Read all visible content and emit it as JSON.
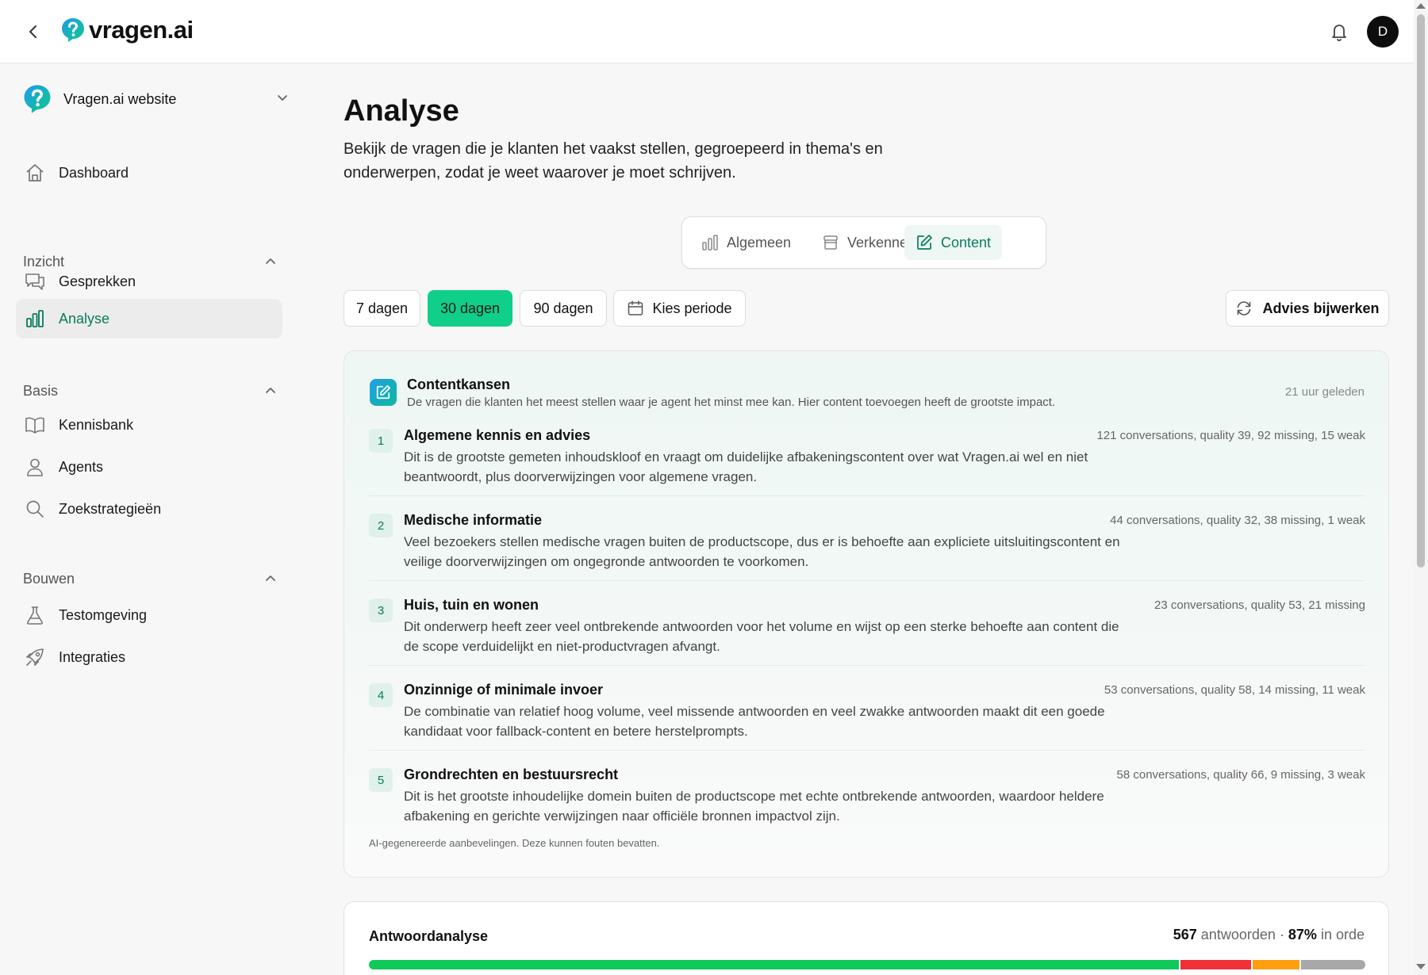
{
  "brand": {
    "name": "vragen.ai",
    "accent": "#0fcf8a"
  },
  "header": {
    "avatar_initial": "D"
  },
  "sidebar": {
    "workspace": "Vragen.ai website",
    "dashboard": "Dashboard",
    "sections": [
      {
        "title": "Inzicht",
        "items": [
          {
            "label": "Gesprekken",
            "icon": "chat-icon"
          },
          {
            "label": "Analyse",
            "icon": "bar-chart-icon",
            "active": true
          }
        ]
      },
      {
        "title": "Basis",
        "items": [
          {
            "label": "Kennisbank",
            "icon": "book-icon"
          },
          {
            "label": "Agents",
            "icon": "user-icon"
          },
          {
            "label": "Zoekstrategieën",
            "icon": "search-icon"
          }
        ]
      },
      {
        "title": "Bouwen",
        "items": [
          {
            "label": "Testomgeving",
            "icon": "flask-icon"
          },
          {
            "label": "Integraties",
            "icon": "rocket-icon"
          }
        ]
      }
    ]
  },
  "page": {
    "title": "Analyse",
    "description": "Bekijk de vragen die je klanten het vaakst stellen, gegroepeerd in thema's en onderwerpen, zodat je weet waarover je moet schrijven."
  },
  "tabs": [
    {
      "label": "Algemeen",
      "icon": "bar-chart-icon"
    },
    {
      "label": "Verkennen",
      "icon": "archive-icon"
    },
    {
      "label": "Content",
      "icon": "edit-icon",
      "active": true
    }
  ],
  "periods": {
    "p7": "7 dagen",
    "p30": "30 dagen",
    "p90": "90 dagen",
    "custom": "Kies periode",
    "selected": "30 dagen"
  },
  "advice_button": "Advies bijwerken",
  "contentkansen": {
    "title": "Contentkansen",
    "subtitle": "De vragen die klanten het meest stellen waar je agent het minst mee kan. Hier content toevoegen heeft de grootste impact.",
    "updated": "21 uur geleden",
    "items": [
      {
        "num": "1",
        "title": "Algemene kennis en advies",
        "desc": "Dit is de grootste gemeten inhoudskloof en vraagt om duidelijke afbakeningscontent over wat Vragen.ai wel en niet beantwoordt, plus doorverwijzingen voor algemene vragen.",
        "stats": "121 conversations, quality 39, 92 missing, 15 weak"
      },
      {
        "num": "2",
        "title": "Medische informatie",
        "desc": "Veel bezoekers stellen medische vragen buiten de productscope, dus er is behoefte aan expliciete uitsluitingscontent en veilige doorverwijzingen om ongegronde antwoorden te voorkomen.",
        "stats": "44 conversations, quality 32, 38 missing, 1 weak"
      },
      {
        "num": "3",
        "title": "Huis, tuin en wonen",
        "desc": "Dit onderwerp heeft zeer veel ontbrekende antwoorden voor het volume en wijst op een sterke behoefte aan content die de scope verduidelijkt en niet-productvragen afvangt.",
        "stats": "23 conversations, quality 53, 21 missing"
      },
      {
        "num": "4",
        "title": "Onzinnige of minimale invoer",
        "desc": "De combinatie van relatief hoog volume, veel missende antwoorden en veel zwakke antwoorden maakt dit een goede kandidaat voor fallback-content en betere herstelprompts.",
        "stats": "53 conversations, quality 58, 14 missing, 11 weak"
      },
      {
        "num": "5",
        "title": "Grondrechten en bestuursrecht",
        "desc": "Dit is het grootste inhoudelijke domein buiten de productscope met echte ontbrekende antwoorden, waardoor heldere afbakening en gerichte verwijzingen naar officiële bronnen impactvol zijn.",
        "stats": "58 conversations, quality 66, 9 missing, 3 weak"
      }
    ],
    "disclaimer": "AI-gegenereerde aanbevelingen. Deze kunnen fouten bevatten."
  },
  "antwoordanalyse": {
    "title": "Antwoordanalyse",
    "count": "567",
    "count_label": "antwoorden",
    "sep": "·",
    "pct": "87%",
    "pct_label": "in orde",
    "segments": [
      {
        "fraction": 0.813,
        "color": "#10c95b"
      },
      {
        "fraction": 0.072,
        "color": "#f0313a"
      },
      {
        "fraction": 0.049,
        "color": "#ff9e0f"
      },
      {
        "fraction": 0.066,
        "color": "#a8a8a8"
      }
    ]
  }
}
